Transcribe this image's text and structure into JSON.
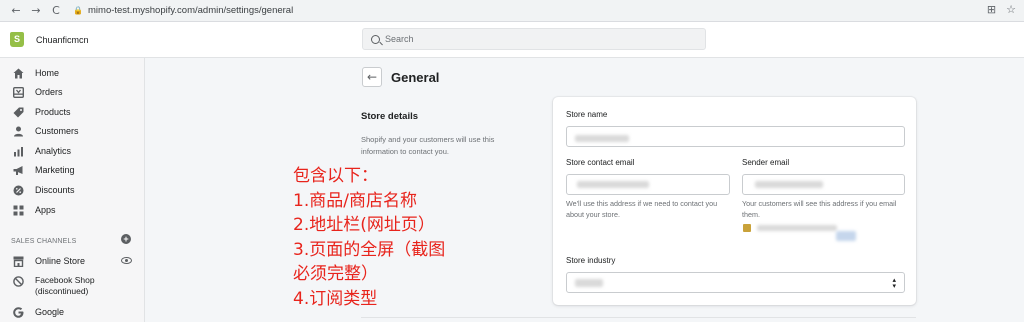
{
  "browser": {
    "back": "←",
    "forward": "→",
    "reload": "C",
    "lock": "🔒",
    "url": "mimo-test.myshopify.com/admin/settings/general",
    "translate": "⊞",
    "star": "☆"
  },
  "topbar": {
    "store_name": "Chuanficmcn",
    "search_placeholder": "Search"
  },
  "sidebar": {
    "items": [
      {
        "label": "Home",
        "icon": "home-icon"
      },
      {
        "label": "Orders",
        "icon": "orders-icon"
      },
      {
        "label": "Products",
        "icon": "tag-icon"
      },
      {
        "label": "Customers",
        "icon": "person-icon"
      },
      {
        "label": "Analytics",
        "icon": "bar-chart-icon"
      },
      {
        "label": "Marketing",
        "icon": "megaphone-icon"
      },
      {
        "label": "Discounts",
        "icon": "discount-icon"
      },
      {
        "label": "Apps",
        "icon": "apps-icon"
      }
    ],
    "sales_channels_heading": "SALES CHANNELS",
    "add_channel": "+",
    "channels": [
      {
        "label": "Online Store",
        "icon": "store-icon"
      },
      {
        "label": "Facebook Shop",
        "label2": "(discontinued)",
        "icon": "prohibited-icon"
      },
      {
        "label": "Google",
        "icon": "google-icon"
      }
    ]
  },
  "main": {
    "back_arrow": "←",
    "title": "General",
    "section_title": "Store details",
    "section_desc": "Shopify and your customers will use this information to contact you.",
    "card": {
      "store_name_label": "Store name",
      "contact_email_label": "Store contact email",
      "contact_email_help": "We'll use this address if we need to contact you about your store.",
      "sender_email_label": "Sender email",
      "sender_email_help": "Your customers will see this address if you email them.",
      "industry_label": "Store industry"
    }
  },
  "annotation": {
    "lines": [
      "包含以下：",
      "1.商品/商店名称",
      "2.地址栏(网址页）",
      "3.页面的全屏（截图",
      "必须完整）",
      "4.订阅类型"
    ],
    "color": "#e8241c"
  }
}
